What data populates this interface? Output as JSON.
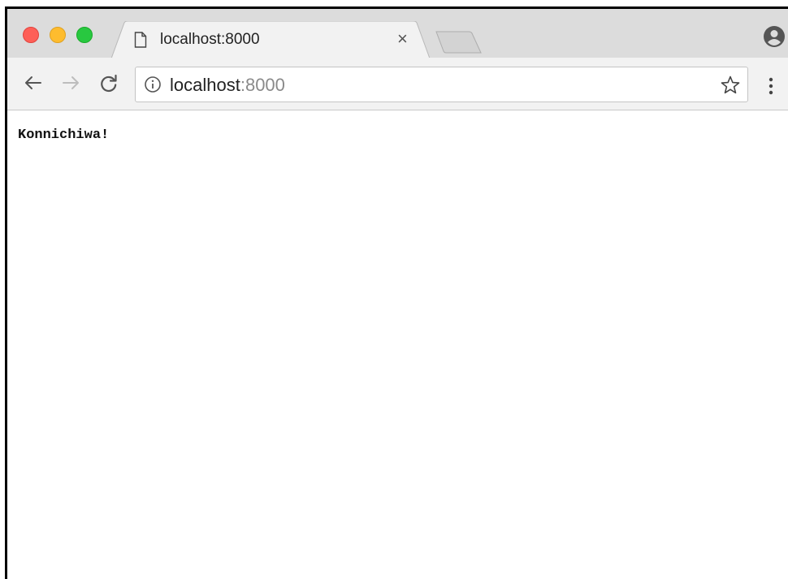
{
  "window": {
    "buttons": [
      "close",
      "minimize",
      "maximize"
    ]
  },
  "tabs": [
    {
      "title": "localhost:8000",
      "icon": "document-icon",
      "active": true
    }
  ],
  "omnibox": {
    "host": "localhost",
    "port": ":8000",
    "security_icon": "info-icon"
  },
  "page": {
    "body_text": "Konnichiwa!"
  },
  "colors": {
    "close": "#fe5f57",
    "minimize": "#febc2e",
    "maximize": "#28c840"
  }
}
